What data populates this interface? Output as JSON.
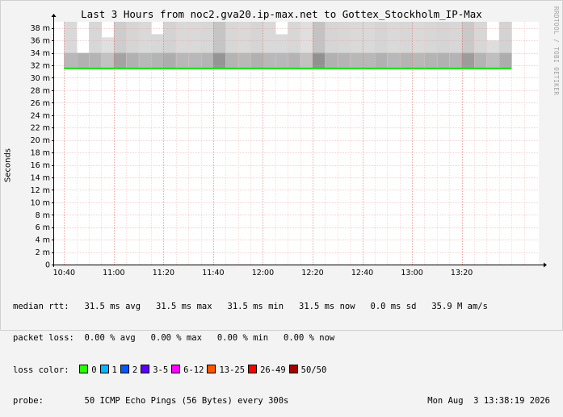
{
  "title": "Last 3 Hours from noc2.gva20.ip-max.net to Gottex_Stockholm_IP-Max",
  "watermark": "RRDTOOL / TOBI OETIKER",
  "chart_data": {
    "type": "area",
    "ylabel": "Seconds",
    "ylim": [
      0,
      0.039
    ],
    "y_ticks": [
      {
        "v": 0,
        "label": "0"
      },
      {
        "v": 0.002,
        "label": "2 m"
      },
      {
        "v": 0.004,
        "label": "4 m"
      },
      {
        "v": 0.006,
        "label": "6 m"
      },
      {
        "v": 0.008,
        "label": "8 m"
      },
      {
        "v": 0.01,
        "label": "10 m"
      },
      {
        "v": 0.012,
        "label": "12 m"
      },
      {
        "v": 0.014,
        "label": "14 m"
      },
      {
        "v": 0.016,
        "label": "16 m"
      },
      {
        "v": 0.018,
        "label": "18 m"
      },
      {
        "v": 0.02,
        "label": "20 m"
      },
      {
        "v": 0.022,
        "label": "22 m"
      },
      {
        "v": 0.024,
        "label": "24 m"
      },
      {
        "v": 0.026,
        "label": "26 m"
      },
      {
        "v": 0.028,
        "label": "28 m"
      },
      {
        "v": 0.03,
        "label": "30 m"
      },
      {
        "v": 0.032,
        "label": "32 m"
      },
      {
        "v": 0.034,
        "label": "34 m"
      },
      {
        "v": 0.036,
        "label": "36 m"
      },
      {
        "v": 0.038,
        "label": "38 m"
      }
    ],
    "x_ticks": [
      "10:40",
      "11:00",
      "11:20",
      "11:40",
      "12:00",
      "12:20",
      "12:40",
      "13:00",
      "13:20"
    ],
    "x_range_minutes": [
      -4,
      191
    ],
    "x_tick_minutes": [
      0,
      20,
      40,
      60,
      80,
      100,
      120,
      140,
      160
    ],
    "median": 0.0315,
    "median_series_minutes": [
      0,
      180
    ],
    "grid": true,
    "colors": {
      "median": "#22e022",
      "grid": "#e8a0a0",
      "smoke": "#a0a0a0"
    },
    "smoke_intervals": [
      {
        "t0": 0,
        "top": 0.039,
        "shade": 0.45
      },
      {
        "t0": 5,
        "top": 0.0335,
        "shade": 0.55
      },
      {
        "t0": 10,
        "top": 0.039,
        "shade": 0.5
      },
      {
        "t0": 15,
        "top": 0.0365,
        "shade": 0.3
      },
      {
        "t0": 20,
        "top": 0.039,
        "shade": 0.75
      },
      {
        "t0": 25,
        "top": 0.039,
        "shade": 0.55
      },
      {
        "t0": 30,
        "top": 0.039,
        "shade": 0.45
      },
      {
        "t0": 35,
        "top": 0.037,
        "shade": 0.5
      },
      {
        "t0": 40,
        "top": 0.039,
        "shade": 0.6
      },
      {
        "t0": 45,
        "top": 0.039,
        "shade": 0.45
      },
      {
        "t0": 50,
        "top": 0.039,
        "shade": 0.45
      },
      {
        "t0": 55,
        "top": 0.039,
        "shade": 0.5
      },
      {
        "t0": 60,
        "top": 0.039,
        "shade": 0.95
      },
      {
        "t0": 65,
        "top": 0.039,
        "shade": 0.5
      },
      {
        "t0": 70,
        "top": 0.039,
        "shade": 0.45
      },
      {
        "t0": 75,
        "top": 0.039,
        "shade": 0.55
      },
      {
        "t0": 80,
        "top": 0.039,
        "shade": 0.45
      },
      {
        "t0": 85,
        "top": 0.037,
        "shade": 0.45
      },
      {
        "t0": 90,
        "top": 0.039,
        "shade": 0.5
      },
      {
        "t0": 95,
        "top": 0.039,
        "shade": 0.3
      },
      {
        "t0": 100,
        "top": 0.039,
        "shade": 1.0
      },
      {
        "t0": 105,
        "top": 0.039,
        "shade": 0.55
      },
      {
        "t0": 110,
        "top": 0.039,
        "shade": 0.5
      },
      {
        "t0": 115,
        "top": 0.039,
        "shade": 0.45
      },
      {
        "t0": 120,
        "top": 0.039,
        "shade": 0.45
      },
      {
        "t0": 125,
        "top": 0.039,
        "shade": 0.55
      },
      {
        "t0": 130,
        "top": 0.039,
        "shade": 0.45
      },
      {
        "t0": 135,
        "top": 0.039,
        "shade": 0.5
      },
      {
        "t0": 140,
        "top": 0.039,
        "shade": 0.45
      },
      {
        "t0": 145,
        "top": 0.039,
        "shade": 0.5
      },
      {
        "t0": 150,
        "top": 0.039,
        "shade": 0.55
      },
      {
        "t0": 155,
        "top": 0.039,
        "shade": 0.5
      },
      {
        "t0": 160,
        "top": 0.039,
        "shade": 0.85
      },
      {
        "t0": 165,
        "top": 0.039,
        "shade": 0.5
      },
      {
        "t0": 170,
        "top": 0.036,
        "shade": 0.35
      },
      {
        "t0": 175,
        "top": 0.039,
        "shade": 0.6
      }
    ],
    "smoke_bottom": 0.0315
  },
  "legend": {
    "median_rtt": "median rtt:   31.5 ms avg   31.5 ms max   31.5 ms min   31.5 ms now   0.0 ms sd   35.9 M am/s",
    "packet_loss": "packet loss:  0.00 % avg   0.00 % max   0.00 % min   0.00 % now",
    "loss_color_label": "loss color:",
    "loss_colors": [
      {
        "label": "0",
        "color": "#26ff00"
      },
      {
        "label": "1",
        "color": "#00b8ff"
      },
      {
        "label": "2",
        "color": "#0059ff"
      },
      {
        "label": "3-5",
        "color": "#5e00ff"
      },
      {
        "label": "6-12",
        "color": "#ff00ff"
      },
      {
        "label": "13-25",
        "color": "#ff5500"
      },
      {
        "label": "26-49",
        "color": "#ff0000"
      },
      {
        "label": "50/50",
        "color": "#a10000"
      }
    ],
    "probe": "probe:        50 ICMP Echo Pings (56 Bytes) every 300s",
    "timestamp": "Mon Aug  3 13:38:19 2026"
  }
}
